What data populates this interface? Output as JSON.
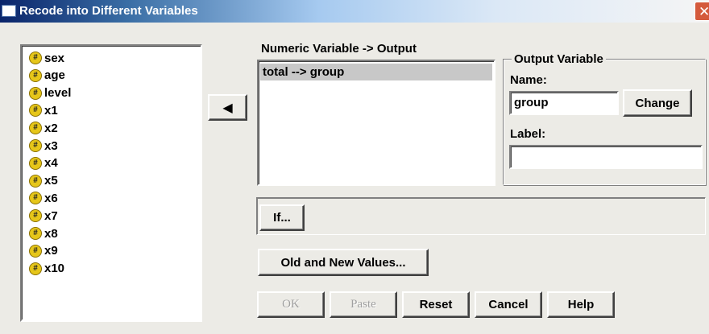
{
  "window": {
    "title": "Recode into Different Variables",
    "close_glyph": "✕"
  },
  "source_variables": [
    {
      "icon": "#",
      "name": "sex"
    },
    {
      "icon": "#",
      "name": "age"
    },
    {
      "icon": "#",
      "name": "level"
    },
    {
      "icon": "#",
      "name": "x1"
    },
    {
      "icon": "#",
      "name": "x2"
    },
    {
      "icon": "#",
      "name": "x3"
    },
    {
      "icon": "#",
      "name": "x4"
    },
    {
      "icon": "#",
      "name": "x5"
    },
    {
      "icon": "#",
      "name": "x6"
    },
    {
      "icon": "#",
      "name": "x7"
    },
    {
      "icon": "#",
      "name": "x8"
    },
    {
      "icon": "#",
      "name": "x9"
    },
    {
      "icon": "#",
      "name": "x10"
    }
  ],
  "move_button": {
    "glyph": "◀",
    "icon": "arrow-left-icon"
  },
  "numeric_variable": {
    "heading": "Numeric Variable -> Output",
    "items": [
      "total --> group"
    ]
  },
  "output_variable": {
    "legend": "Output Variable",
    "name_label": "Name:",
    "name_value": "group",
    "change_label": "Change",
    "label_label": "Label:",
    "label_value": ""
  },
  "if_button": "If...",
  "old_new_button": "Old and New Values...",
  "footer": {
    "ok": "OK",
    "paste": "Paste",
    "reset": "Reset",
    "cancel": "Cancel",
    "help": "Help"
  }
}
